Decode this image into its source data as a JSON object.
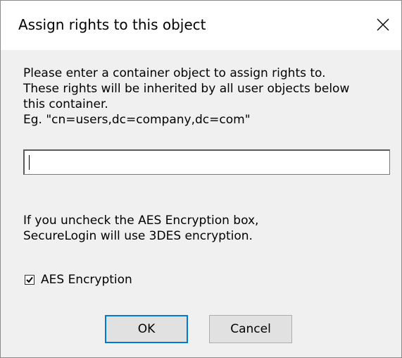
{
  "window": {
    "title": "Assign rights to this object",
    "close_icon": "close-icon"
  },
  "description": {
    "lines": [
      "Please enter a container object to assign rights to.",
      "These rights will be inherited by all user objects below",
      "this container.",
      "Eg. \"cn=users,dc=company,dc=com\""
    ]
  },
  "container_input": {
    "value": "",
    "placeholder": ""
  },
  "aes_note": {
    "lines": [
      "If you uncheck the AES Encryption box,",
      "SecureLogin will use 3DES encryption."
    ]
  },
  "aes_checkbox": {
    "label": "AES Encryption",
    "checked": true
  },
  "buttons": {
    "ok_label": "OK",
    "cancel_label": "Cancel"
  },
  "colors": {
    "accent": "#0078d7",
    "dialog_bg": "#f0f0f0",
    "titlebar_bg": "#ffffff"
  }
}
